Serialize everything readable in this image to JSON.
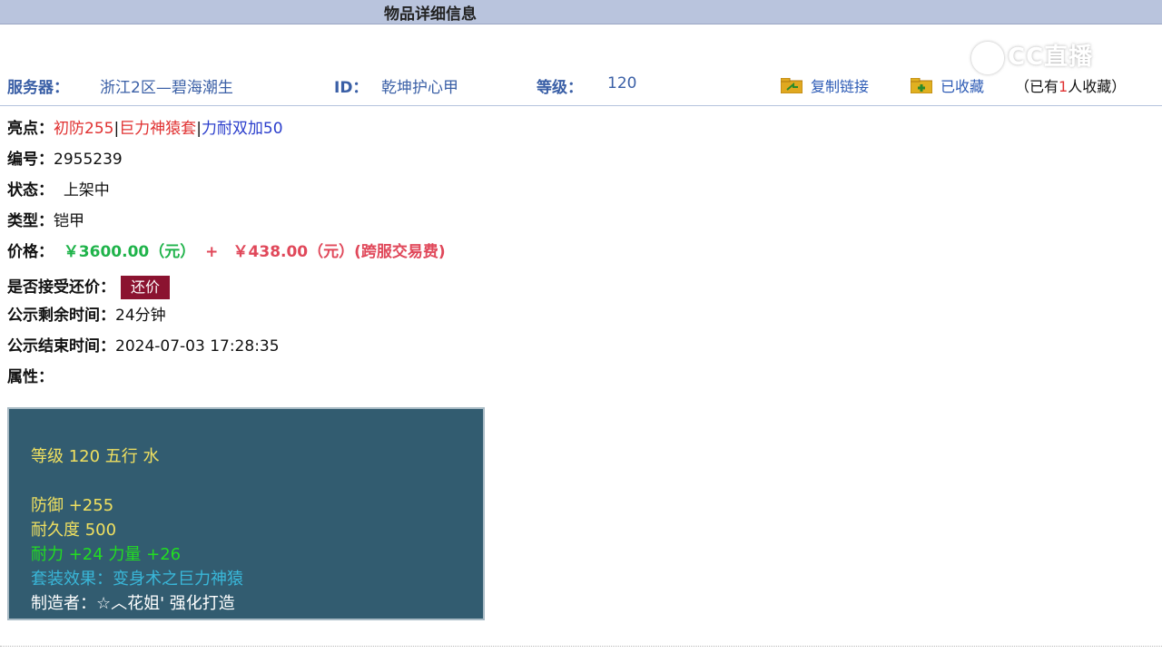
{
  "title": "物品详细信息",
  "watermark": "CC直播",
  "server": {
    "label": "服务器：",
    "value": "浙江2区—碧海潮生"
  },
  "id": {
    "label": "ID：",
    "value": "乾坤护心甲"
  },
  "level": {
    "label": "等级：",
    "value": "120"
  },
  "actions": {
    "copy_link": "复制链接",
    "favorited": "已收藏",
    "fav_count_prefix": "（已有",
    "fav_count": "1",
    "fav_count_suffix": "人收藏）"
  },
  "fields": {
    "highlights_label": "亮点：",
    "highlights": [
      "初防255",
      "巨力神猿套",
      "力耐双加50"
    ],
    "sep": "|",
    "number_label": "编号：",
    "number": "2955239",
    "status_label": "状态：",
    "status": "上架中",
    "type_label": "类型：",
    "type": "铠甲",
    "price_label": "价格：",
    "price": "￥3600.00（元）",
    "plus": "+",
    "fee": "￥438.00（元）(跨服交易费)",
    "counter_label": "是否接受还价：",
    "counter_button": "还价",
    "remaining_label": "公示剩余时间：",
    "remaining": "24分钟",
    "end_label": "公示结束时间：",
    "end": "2024-07-03 17:28:35",
    "attrs_label": "属性："
  },
  "attributes": {
    "line1": "等级 120 五行 水",
    "line2": "防御 +255",
    "line3": "耐久度 500",
    "line4": "耐力 +24 力量 +26",
    "line5": "套装效果：变身术之巨力神猿",
    "line6": "制造者：☆︿花姐' 强化打造"
  },
  "colors": {
    "title_bar": "#b9c4dd",
    "label_blue": "#3a5fa6",
    "highlight_red": "#e03030",
    "highlight_blue": "#2b3ecc",
    "price_green": "#1fb34a",
    "fee_red": "#e0485a",
    "button": "#8b1330",
    "attr_bg": "#325c70",
    "attr_yellow": "#f0e060",
    "attr_green": "#22dd22",
    "attr_cyan": "#39b7d9",
    "attr_white": "#ffffff"
  }
}
